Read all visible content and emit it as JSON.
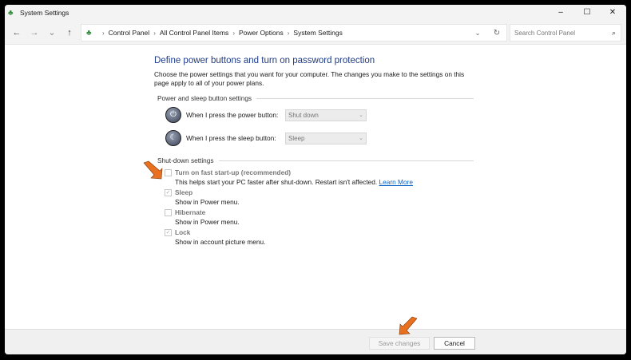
{
  "window": {
    "title": "System Settings",
    "minimize": "–",
    "maximize": "☐",
    "close": "✕"
  },
  "nav": {
    "back": "←",
    "forward": "→",
    "recent": "⌄",
    "up": "↑"
  },
  "breadcrumb": [
    "Control Panel",
    "All Control Panel Items",
    "Power Options",
    "System Settings"
  ],
  "search": {
    "placeholder": "Search Control Panel"
  },
  "main": {
    "title": "Define power buttons and turn on password protection",
    "description": "Choose the power settings that you want for your computer. The changes you make to the settings on this page apply to all of your power plans.",
    "power_group": "Power and sleep button settings",
    "power_rows": [
      {
        "label": "When I press the power button:",
        "value": "Shut down"
      },
      {
        "label": "When I press the sleep button:",
        "value": "Sleep"
      }
    ],
    "shutdown_group": "Shut-down settings",
    "options": [
      {
        "label": "Turn on fast start-up (recommended)",
        "checked": false,
        "desc": "This helps start your PC faster after shut-down. Restart isn't affected.",
        "link": "Learn More"
      },
      {
        "label": "Sleep",
        "checked": true,
        "desc": "Show in Power menu."
      },
      {
        "label": "Hibernate",
        "checked": false,
        "desc": "Show in Power menu."
      },
      {
        "label": "Lock",
        "checked": true,
        "desc": "Show in account picture menu."
      }
    ]
  },
  "footer": {
    "save": "Save changes",
    "cancel": "Cancel"
  },
  "colors": {
    "accent_arrow": "#e8701e",
    "title": "#1f3c88",
    "link": "#0b63c5"
  }
}
